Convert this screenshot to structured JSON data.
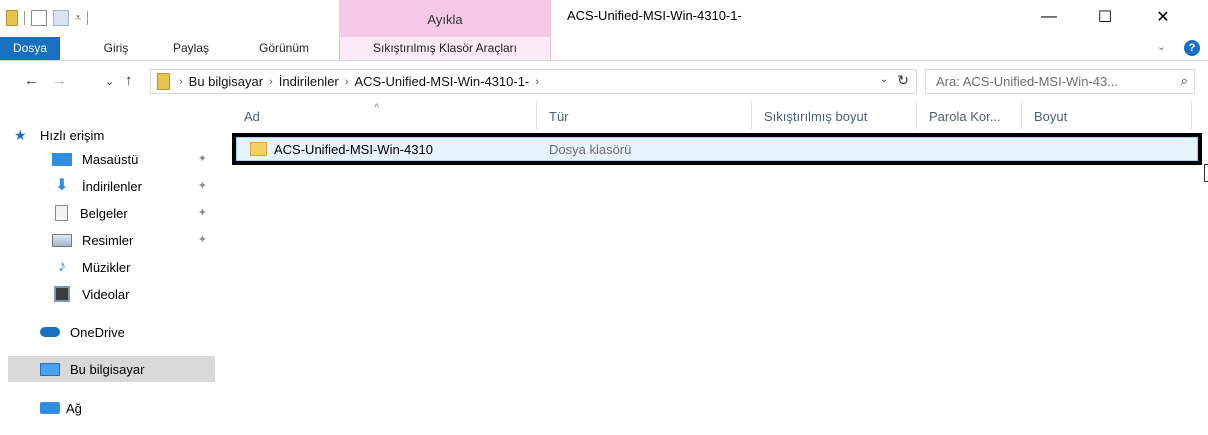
{
  "window": {
    "title": "ACS-Unified-MSI-Win-4310-1-",
    "context_tab_group": "Ayıkla",
    "minimize_glyph": "—",
    "maximize_glyph": "☐",
    "close_glyph": "✕"
  },
  "ribbon": {
    "tabs": [
      "Dosya",
      "Giriş",
      "Paylaş",
      "Görünüm"
    ],
    "context_tab": "Sıkıştırılmış Klasör Araçları",
    "chevron": "⌄",
    "help": "?"
  },
  "nav": {
    "back": "←",
    "forward": "→",
    "recent": "⌄",
    "up": "↑",
    "breadcrumb": [
      "Bu bilgisayar",
      "İndirilenler",
      "ACS-Unified-MSI-Win-4310-1-"
    ],
    "separator": "›",
    "dropdown": "⌄",
    "refresh": "↻",
    "search_placeholder": "Ara: ACS-Unified-MSI-Win-43...",
    "search_icon": "⌕"
  },
  "sidebar": {
    "quick_access": "Hızlı erişim",
    "items": [
      {
        "label": "Masaüstü",
        "icon": "desktop-icon",
        "pinned": true
      },
      {
        "label": "İndirilenler",
        "icon": "download-icon",
        "pinned": true
      },
      {
        "label": "Belgeler",
        "icon": "documents-icon",
        "pinned": true
      },
      {
        "label": "Resimler",
        "icon": "pictures-icon",
        "pinned": true
      },
      {
        "label": "Müzikler",
        "icon": "music-icon",
        "pinned": false
      },
      {
        "label": "Videolar",
        "icon": "video-icon",
        "pinned": false
      }
    ],
    "onedrive": "OneDrive",
    "this_pc": "Bu bilgisayar",
    "network": "Ağ",
    "pin_glyph": "📌"
  },
  "list": {
    "columns": [
      "Ad",
      "Tür",
      "Sıkıştırılmış boyut",
      "Parola Kor...",
      "Boyut"
    ],
    "sort_caret": "^",
    "rows": [
      {
        "name": "ACS-Unified-MSI-Win-4310",
        "type": "Dosya klasörü"
      }
    ]
  },
  "colors": {
    "file_tab": "#1a6fc0",
    "context_tab": "#f6c9e8",
    "selection": "#e5f3ff",
    "highlight_border": "#000000"
  }
}
